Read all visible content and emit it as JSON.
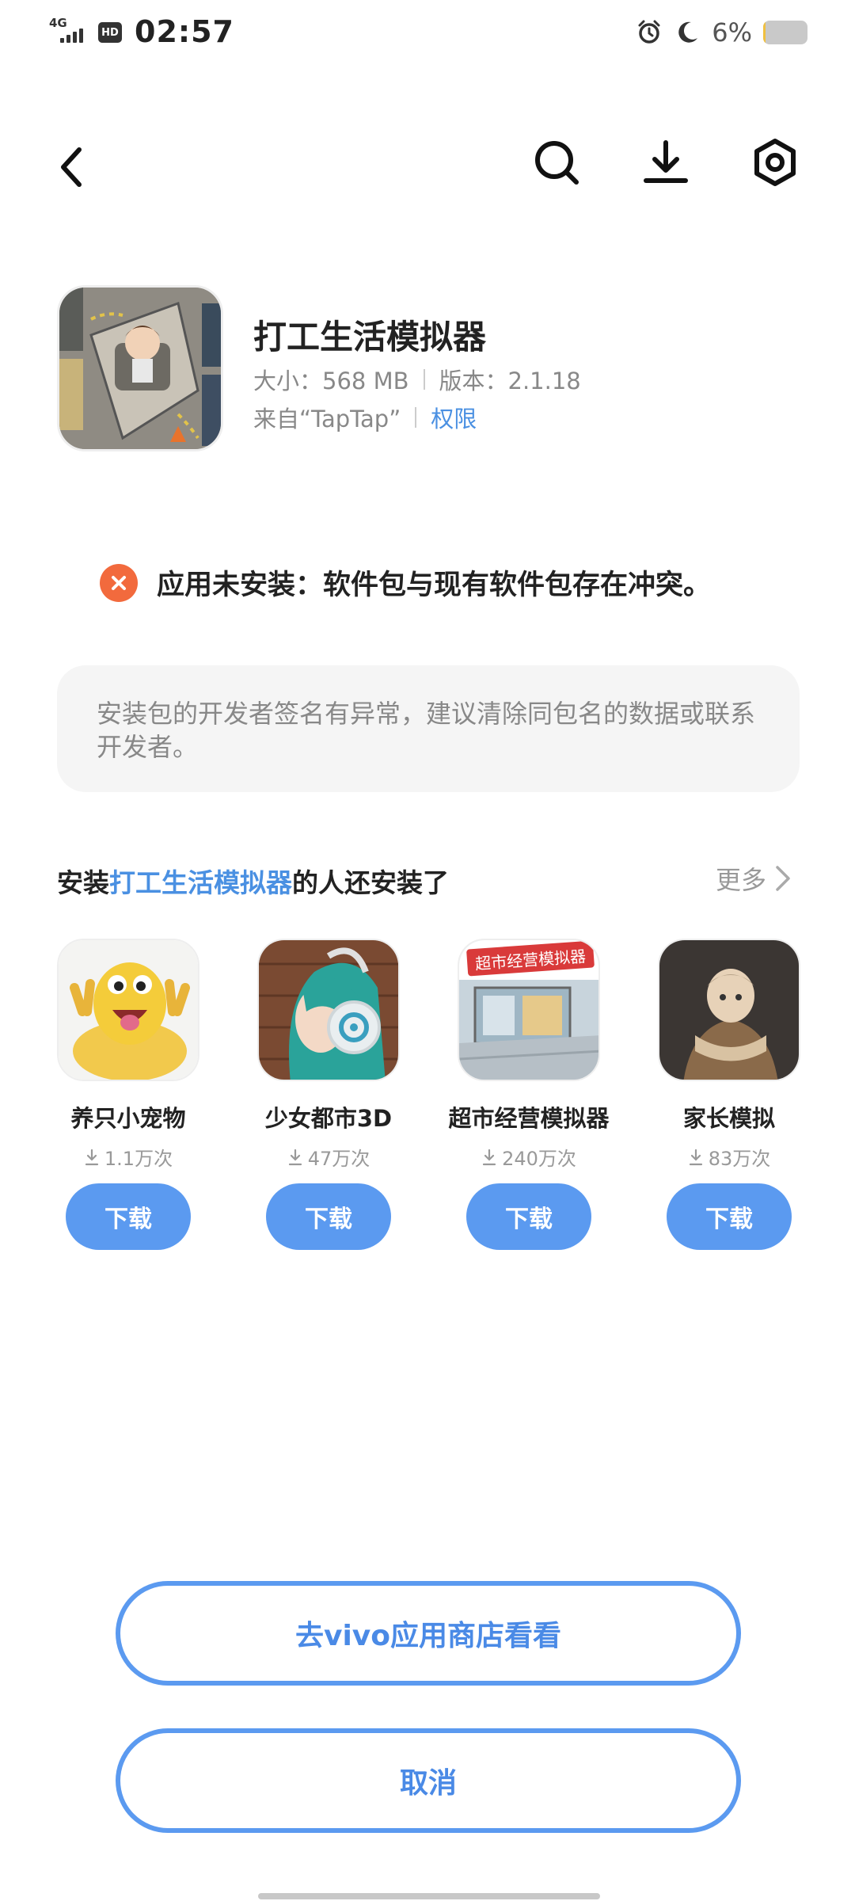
{
  "status_bar": {
    "network": "4G",
    "hd": "HD",
    "time": "02:57",
    "battery_text": "6%",
    "battery_level": 0.06
  },
  "app": {
    "name": "打工生活模拟器",
    "size_label": "大小：568 MB",
    "version_label": "版本：2.1.18",
    "source_label": "来自“TapTap”",
    "permission_label": "权限"
  },
  "error": {
    "message": "应用未安装：软件包与现有软件包存在冲突。",
    "hint": "安装包的开发者签名有异常，建议清除同包名的数据或联系开发者。"
  },
  "recommend": {
    "title_prefix": "安装",
    "title_app": "打工生活模拟器",
    "title_suffix": "的人还安装了",
    "more": "更多",
    "items": [
      {
        "name": "养只小宠物",
        "count": "1.1万次",
        "button": "下载"
      },
      {
        "name": "少女都市3D",
        "count": "47万次",
        "button": "下载"
      },
      {
        "name": "超市经营模拟器",
        "count": "240万次",
        "button": "下载",
        "icon_text": "超市经营模拟器"
      },
      {
        "name": "家长模拟",
        "count": "83万次",
        "button": "下载"
      }
    ]
  },
  "actions": {
    "store_button": "去vivo应用商店看看",
    "cancel_button": "取消"
  },
  "colors": {
    "accent": "#4a90e2",
    "button": "#5b9af0",
    "error": "#f26a3d"
  }
}
